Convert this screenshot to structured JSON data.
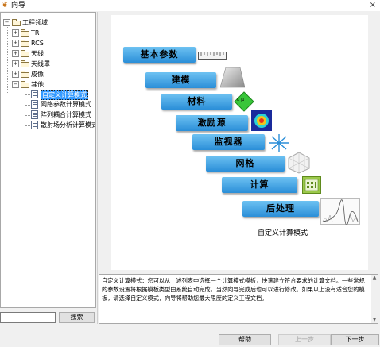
{
  "window": {
    "title": "向导",
    "app_icon": "wizard-app-icon",
    "close_icon": "close-icon",
    "close_glyph": "×"
  },
  "tree": {
    "root": "工程领域",
    "nodes": [
      "TR",
      "RCS",
      "天线",
      "天线罩",
      "成像",
      "其他"
    ],
    "other_children": [
      "自定义计算模式",
      "网络参数计算模式",
      "阵列耦合计算模式",
      "散射场分析计算模式"
    ],
    "selected": "自定义计算模式"
  },
  "search": {
    "value": "",
    "button_label": "搜索"
  },
  "workflow": {
    "steps": [
      {
        "label": "基本参数",
        "icon": "ruler-icon"
      },
      {
        "label": "建模",
        "icon": "shape-icon"
      },
      {
        "label": "材料",
        "icon": "material-icon"
      },
      {
        "label": "激励源",
        "icon": "excitation-icon"
      },
      {
        "label": "监视器",
        "icon": "monitor-icon"
      },
      {
        "label": "网格",
        "icon": "mesh-icon"
      },
      {
        "label": "计算",
        "icon": "calculator-icon"
      },
      {
        "label": "后处理",
        "icon": "plot-icon"
      }
    ],
    "caption": "自定义计算模式",
    "material_icon_text": "ε μ"
  },
  "description": "自定义计算模式：您可以从上述列表中选择一个计算模式模板，快速建立符合要求的计算文档。一些常规的参数设置将根据模板类型由系统自动完成，当然向导完成后也可以进行修改。如果以上没有适合您的模板，请选择自定义模式，向导将帮助您最大限度的定义工程文档。",
  "buttons": {
    "help": "帮助",
    "prev": "上一步",
    "next": "下一步"
  },
  "colors": {
    "step_fill": "#2a8ed8",
    "selection": "#3399ff"
  }
}
